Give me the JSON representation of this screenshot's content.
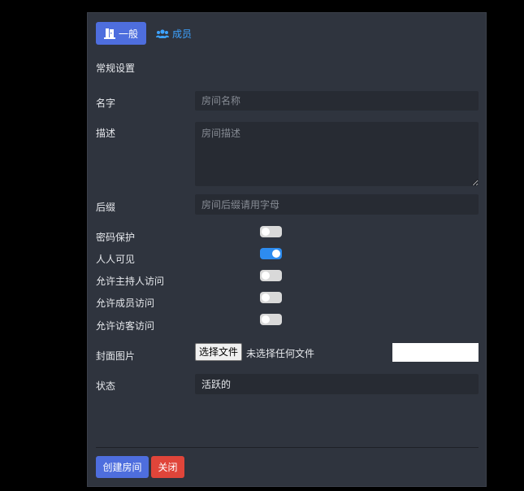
{
  "tabs": [
    {
      "label": "一般",
      "icon": "door-icon"
    },
    {
      "label": "成员",
      "icon": "users-icon"
    }
  ],
  "section_title": "常规设置",
  "fields": {
    "name": {
      "label": "名字",
      "placeholder": "房间名称",
      "value": ""
    },
    "description": {
      "label": "描述",
      "placeholder": "房间描述",
      "value": ""
    },
    "suffix": {
      "label": "后缀",
      "placeholder": "房间后缀请用字母",
      "value": ""
    }
  },
  "toggles": [
    {
      "label": "密码保护",
      "on": false
    },
    {
      "label": "人人可见",
      "on": true
    },
    {
      "label": "允许主持人访问",
      "on": false
    },
    {
      "label": "允许成员访问",
      "on": false
    },
    {
      "label": "允许访客访问",
      "on": false
    }
  ],
  "cover": {
    "label": "封面图片",
    "button": "选择文件",
    "status": "未选择任何文件"
  },
  "status": {
    "label": "状态",
    "value": "活跃的"
  },
  "buttons": {
    "create": "创建房间",
    "close": "关闭"
  },
  "colors": {
    "accent": "#4e6ede",
    "danger": "#e0453a",
    "toggle_on": "#2d8cf0",
    "link": "#3da2ff"
  }
}
